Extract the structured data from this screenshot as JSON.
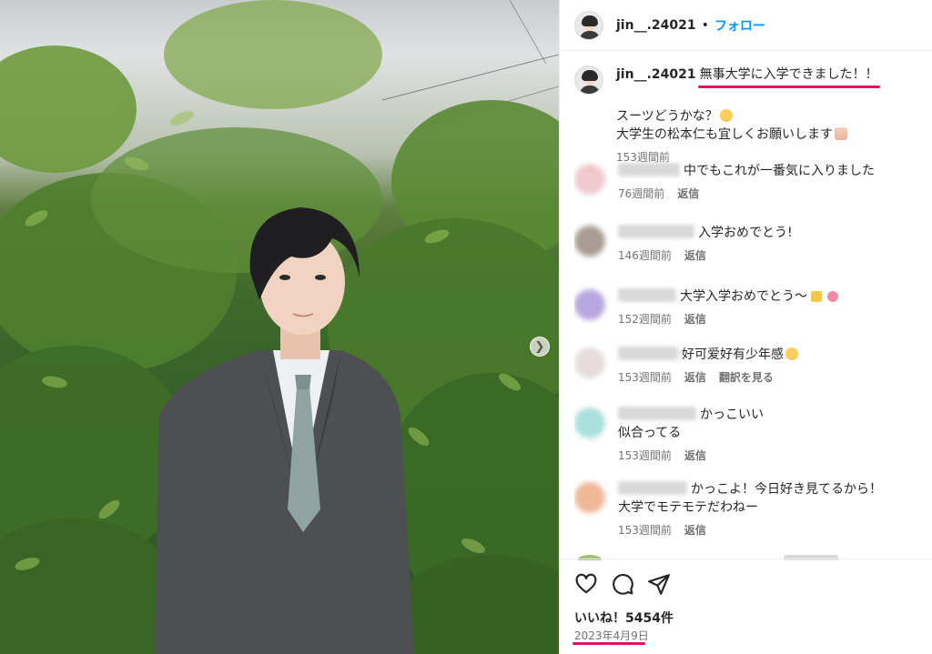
{
  "post": {
    "username": "jin__.24021",
    "header_separator": "•",
    "follow_label": "フォロー",
    "caption_highlight": "無事大学に入学できました！！",
    "caption_line1": "スーツどうかな？",
    "caption_line2": "大学生の松本仁も宜しくお願いします",
    "caption_time": "153週間前",
    "likes": "いいね！5454件",
    "date": "2023年4月9日"
  },
  "comments": [
    {
      "text": "中でもこれが一番気に入りました",
      "time": "76週間前",
      "reply": "返信",
      "translate": ""
    },
    {
      "text": "入学おめでとう!",
      "time": "146週間前",
      "reply": "返信",
      "translate": ""
    },
    {
      "text": "大学入学おめでとう〜",
      "time": "152週間前",
      "reply": "返信",
      "translate": ""
    },
    {
      "text": "好可爱好有少年感",
      "time": "153週間前",
      "reply": "返信",
      "translate": "翻訳を見る"
    },
    {
      "text": "かっこいい",
      "text2": "似合ってる",
      "time": "153週間前",
      "reply": "返信",
      "translate": ""
    },
    {
      "text": "かっこよ！今日好き見てるから！",
      "text2": "大学でモテモテだわねー",
      "time": "153週間前",
      "reply": "返信",
      "translate": ""
    }
  ],
  "colors": {
    "accent_follow": "#0095f6",
    "highlight_underline": "#e60f63",
    "meta_text": "#737373"
  },
  "icons": [
    "heart-icon",
    "comment-icon",
    "share-icon",
    "carousel-next-icon"
  ]
}
